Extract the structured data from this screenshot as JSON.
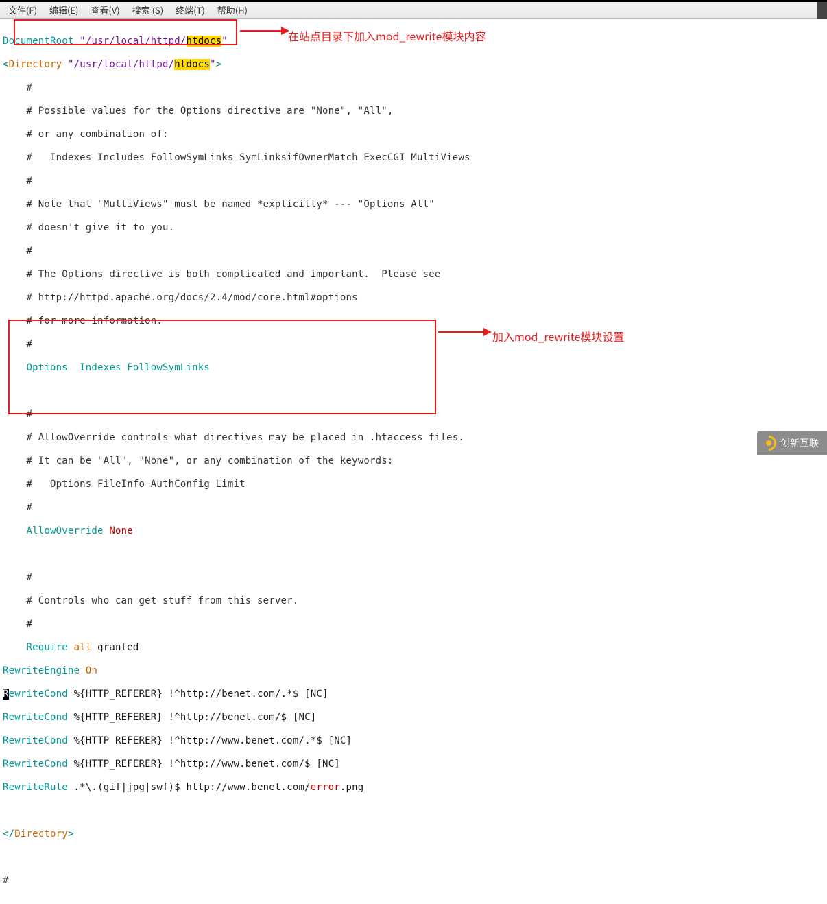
{
  "menu": {
    "file": "文件(F)",
    "edit": "编辑(E)",
    "view": "查看(V)",
    "search": "搜索 (S)",
    "terminal": "终端(T)",
    "help": "帮助(H)"
  },
  "annotation": {
    "top": "在站点目录下加入mod_rewrite模块内容",
    "bottom": "加入mod_rewrite模块设置"
  },
  "config": {
    "doc_root_key": "DocumentRoot",
    "doc_root_q1": " \"",
    "doc_root_path": "/usr/local/httpd/",
    "doc_root_hl": "htdocs",
    "doc_root_q2": "\"",
    "dir_open_l": "<",
    "dir_open_kw": "Directory",
    "dir_open_q1": " \"",
    "dir_open_path": "/usr/local/httpd/",
    "dir_open_hl": "htdocs",
    "dir_open_q2": "\"",
    "dir_open_r": ">",
    "c1": "    #",
    "c2": "    # Possible values for the Options directive are \"None\", \"All\",",
    "c3": "    # or any combination of:",
    "c4": "    #   Indexes Includes FollowSymLinks SymLinksifOwnerMatch ExecCGI MultiViews",
    "c5": "    #",
    "c6": "    # Note that \"MultiViews\" must be named *explicitly* --- \"Options All\"",
    "c7": "    # doesn't give it to you.",
    "c8": "    #",
    "c9": "    # The Options directive is both complicated and important.  Please see",
    "c10": "    # http://httpd.apache.org/docs/2.4/mod/core.html#options",
    "c11": "    # for more information.",
    "c12": "    #",
    "opt_key": "    Options",
    "opt_val": "  Indexes FollowSymLinks",
    "c13": "    #",
    "c14": "    # AllowOverride controls what directives may be placed in .htaccess files.",
    "c15": "    # It can be \"All\", \"None\", or any combination of the keywords:",
    "c16": "    #   Options FileInfo AuthConfig Limit",
    "c17": "    #",
    "ao_key": "    AllowOverride",
    "ao_val": " None",
    "c18": "    #",
    "c19": "    # Controls who can get stuff from this server.",
    "c20": "    #",
    "req_key": "    Require",
    "req_all": " all",
    "req_granted": " granted",
    "re_eng_key": "RewriteEngine",
    "re_eng_val": " On",
    "rc_key": "RewriteCond",
    "rc_cursor": "R",
    "rc_rest1": "ewriteCond",
    "rc1": " %{HTTP_REFERER} !^http://benet.com/.*$ [NC]",
    "rc2": " %{HTTP_REFERER} !^http://benet.com/$ [NC]",
    "rc3": " %{HTTP_REFERER} !^http://www.benet.com/.*$ [NC]",
    "rc4": " %{HTTP_REFERER} !^http://www.benet.com/$ [NC]",
    "rr_key": "RewriteRule",
    "rr_pat": " .*\\.(gif|jpg|swf)$ http://www.benet.com/",
    "rr_err": "error",
    "rr_ext": ".png",
    "dir_close_l": "<",
    "dir_close_s": "/",
    "dir_close_kw": "Directory",
    "dir_close_r": ">",
    "trailing": "#"
  },
  "watermark": "创新互联"
}
